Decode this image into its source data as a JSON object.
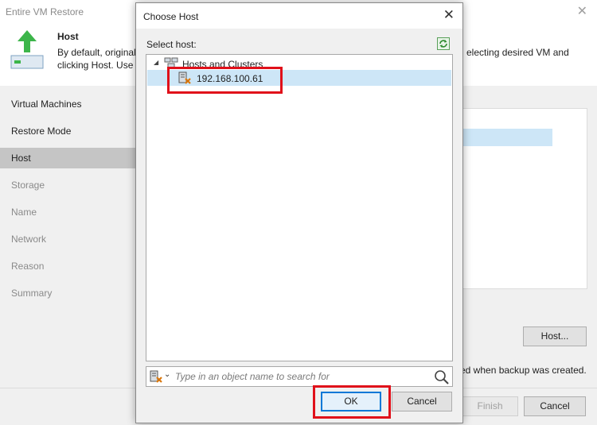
{
  "wizard": {
    "title": "Entire VM Restore",
    "header": {
      "title": "Host",
      "desc_line1": "By default, original",
      "desc_line2": "clicking Host. Use r",
      "desc_right": "electing desired VM and"
    },
    "steps": [
      {
        "label": "Virtual Machines",
        "state": "done"
      },
      {
        "label": "Restore Mode",
        "state": "done"
      },
      {
        "label": "Host",
        "state": "active"
      },
      {
        "label": "Storage",
        "state": "pending"
      },
      {
        "label": "Name",
        "state": "pending"
      },
      {
        "label": "Network",
        "state": "pending"
      },
      {
        "label": "Reason",
        "state": "pending"
      },
      {
        "label": "Summary",
        "state": "pending"
      }
    ],
    "host_button": "Host...",
    "note_text": "ed when backup was created.",
    "finish_button": "Finish",
    "cancel_button": "Cancel"
  },
  "dialog": {
    "title": "Choose Host",
    "select_label": "Select host:",
    "tree": {
      "root_label": "Hosts and Clusters",
      "host_label": "192.168.100.61"
    },
    "search": {
      "placeholder": "Type in an object name to search for"
    },
    "ok_button": "OK",
    "cancel_button": "Cancel"
  },
  "colors": {
    "highlight_red": "#e0101a",
    "selection_blue": "#cde6f7",
    "accent_blue": "#0078d7",
    "arrow_green": "#3cb54a"
  }
}
